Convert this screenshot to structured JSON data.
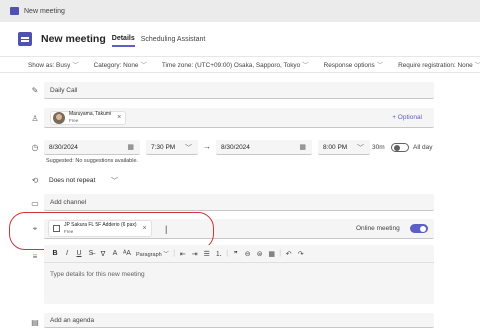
{
  "window": {
    "title": "New meeting"
  },
  "header": {
    "title": "New meeting",
    "tabs": [
      {
        "label": "Details",
        "active": true
      },
      {
        "label": "Scheduling Assistant",
        "active": false
      }
    ]
  },
  "options_bar": [
    {
      "label": "Show as: Busy"
    },
    {
      "label": "Category: None"
    },
    {
      "label": "Time zone: (UTC+09:00) Osaka, Sapporo, Tokyo"
    },
    {
      "label": "Response options"
    },
    {
      "label": "Require registration: None"
    }
  ],
  "meeting": {
    "title": "Daily Call"
  },
  "attendees": {
    "chip": {
      "name": "Maruyama, Takumi",
      "status": "Free"
    },
    "optional_label": "+ Optional"
  },
  "datetime": {
    "start_date": "8/30/2024",
    "start_time": "7:30 PM",
    "end_date": "8/30/2024",
    "end_time": "8:00 PM",
    "duration": "30m",
    "all_day_label": "All day",
    "suggested_label": "Suggested: No suggestions available."
  },
  "repeat": {
    "value": "Does not repeat"
  },
  "channel": {
    "placeholder": "Add channel"
  },
  "location": {
    "chip": {
      "name": "JP Sakura FL 5F Adderio (6 pax)",
      "status": "Free"
    },
    "online_label": "Online meeting",
    "online_on": true
  },
  "editor": {
    "paragraph_label": "Paragraph",
    "placeholder": "Type details for this new meeting"
  },
  "agenda": {
    "placeholder": "Add an agenda"
  },
  "colors": {
    "accent": "#5b5fc7",
    "annotation": "#d13438"
  }
}
